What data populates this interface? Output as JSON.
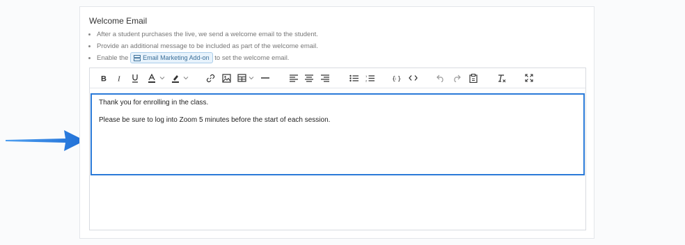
{
  "section": {
    "title": "Welcome Email",
    "notes": [
      "After a student purchases the live, we send a welcome email to the student.",
      "Provide an additional message to be included as part of the welcome email.",
      {
        "prefix": "Enable the",
        "addon_label": "Email Marketing Add-on",
        "suffix": "to set the welcome email."
      }
    ]
  },
  "editor": {
    "toolbar_icons": [
      "bold-icon",
      "italic-icon",
      "underline-icon",
      "text-color-icon",
      "highlight-icon",
      "link-icon",
      "image-icon",
      "table-icon",
      "horizontal-rule-icon",
      "align-left-icon",
      "align-center-icon",
      "align-right-icon",
      "bullet-list-icon",
      "numbered-list-icon",
      "variable-icon",
      "code-icon",
      "undo-icon",
      "redo-icon",
      "paste-icon",
      "clear-format-icon",
      "fullscreen-icon"
    ],
    "paragraphs": [
      "Thank you for enrolling in the class.",
      "Please be sure to log into Zoom 5 minutes before the start of each session."
    ]
  },
  "colors": {
    "highlight_border": "#2a7ad8",
    "arrow": "#2a7ad8",
    "addon_bg": "#e8f3fc"
  }
}
